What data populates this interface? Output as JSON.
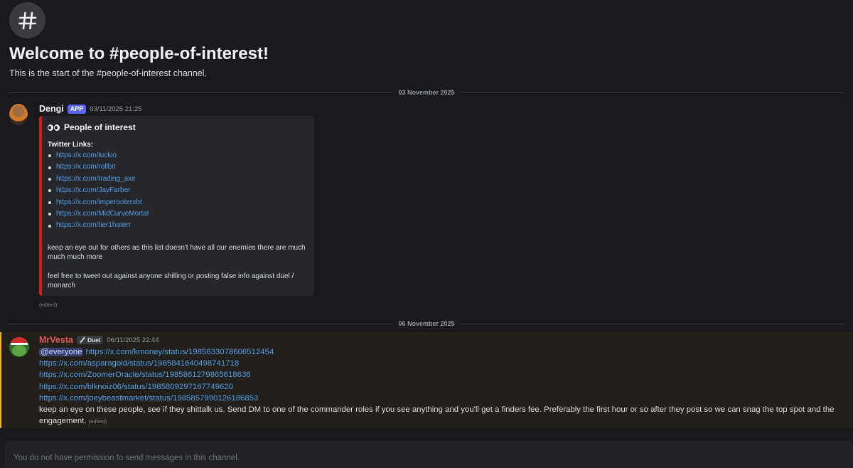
{
  "channel": {
    "hash_icon": "hashtag-icon",
    "welcome_title": "Welcome to #people-of-interest!",
    "welcome_subtitle": "This is the start of the #people-of-interest channel."
  },
  "dividers": [
    "03 November 2025",
    "06 November 2025"
  ],
  "message1": {
    "username": "Dengi",
    "badge": "APP",
    "timestamp": "03/11/2025 21:25",
    "embed": {
      "accent_color": "#d41e1e",
      "title_icon": "eyes-icon",
      "title": "People of interest",
      "field_name": "Twitter Links:",
      "links": [
        "https://x.com/luckio",
        "https://x.com/rollbit",
        "https://x.com/trading_axe",
        "https://x.com/JayFarber",
        "https://x.com/imperooterxbt",
        "https://x.com/MidCurveMortal",
        "https://x.com/tier1haterr"
      ],
      "text1": "keep an eye out for others as this list doesn't have all our enemies there are much much much more",
      "text2": "feel free to tweet out against anyone shilling or posting false info against duel / monarch"
    },
    "edited": "(edited)"
  },
  "message2": {
    "username": "MrVesta",
    "tag": "Duel",
    "timestamp": "06/11/2025 22:44",
    "mention": "@everyone",
    "links": [
      "https://x.com/kmoney/status/1985633078606512454",
      "https://x.com/asparagoid/status/1985841640498741718",
      "https://x.com/ZoomerOracle/status/1985861279865618636",
      "https://x.com/blknoiz06/status/1985809297167749620",
      "https://x.com/joeybeastmarket/status/1985857990126186853"
    ],
    "text": "keep an eye on these people, see if they shittalk us. Send DM to one of the commander roles if you see anything and you'll get a finders fee. Preferably the first hour or so after they post so we can snag the top spot and the engagement.",
    "edited": "(edited)"
  },
  "input": {
    "placeholder": "You do not have permission to send messages in this channel."
  },
  "colors": {
    "background": "#1a1a1e",
    "link": "#4f9fe8",
    "mention_highlight": "#f0b232",
    "app_badge": "#5865f2"
  }
}
